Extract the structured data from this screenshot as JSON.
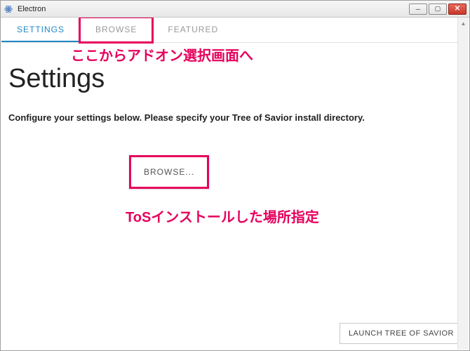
{
  "window": {
    "title": "Electron"
  },
  "tabs": {
    "settings": "SETTINGS",
    "browse": "BROWSE",
    "featured": "FEATURED"
  },
  "page": {
    "heading": "Settings",
    "description": "Configure your settings below. Please specify your Tree of Savior install directory.",
    "browse_button": "BROWSE...",
    "launch_button": "LAUNCH TREE OF SAVIOR"
  },
  "annotations": {
    "tab_note": "ここからアドオン選択画面へ",
    "browse_note": "ToSインストールした場所指定"
  },
  "colors": {
    "accent": "#1e88c7",
    "highlight": "#e6005c"
  }
}
